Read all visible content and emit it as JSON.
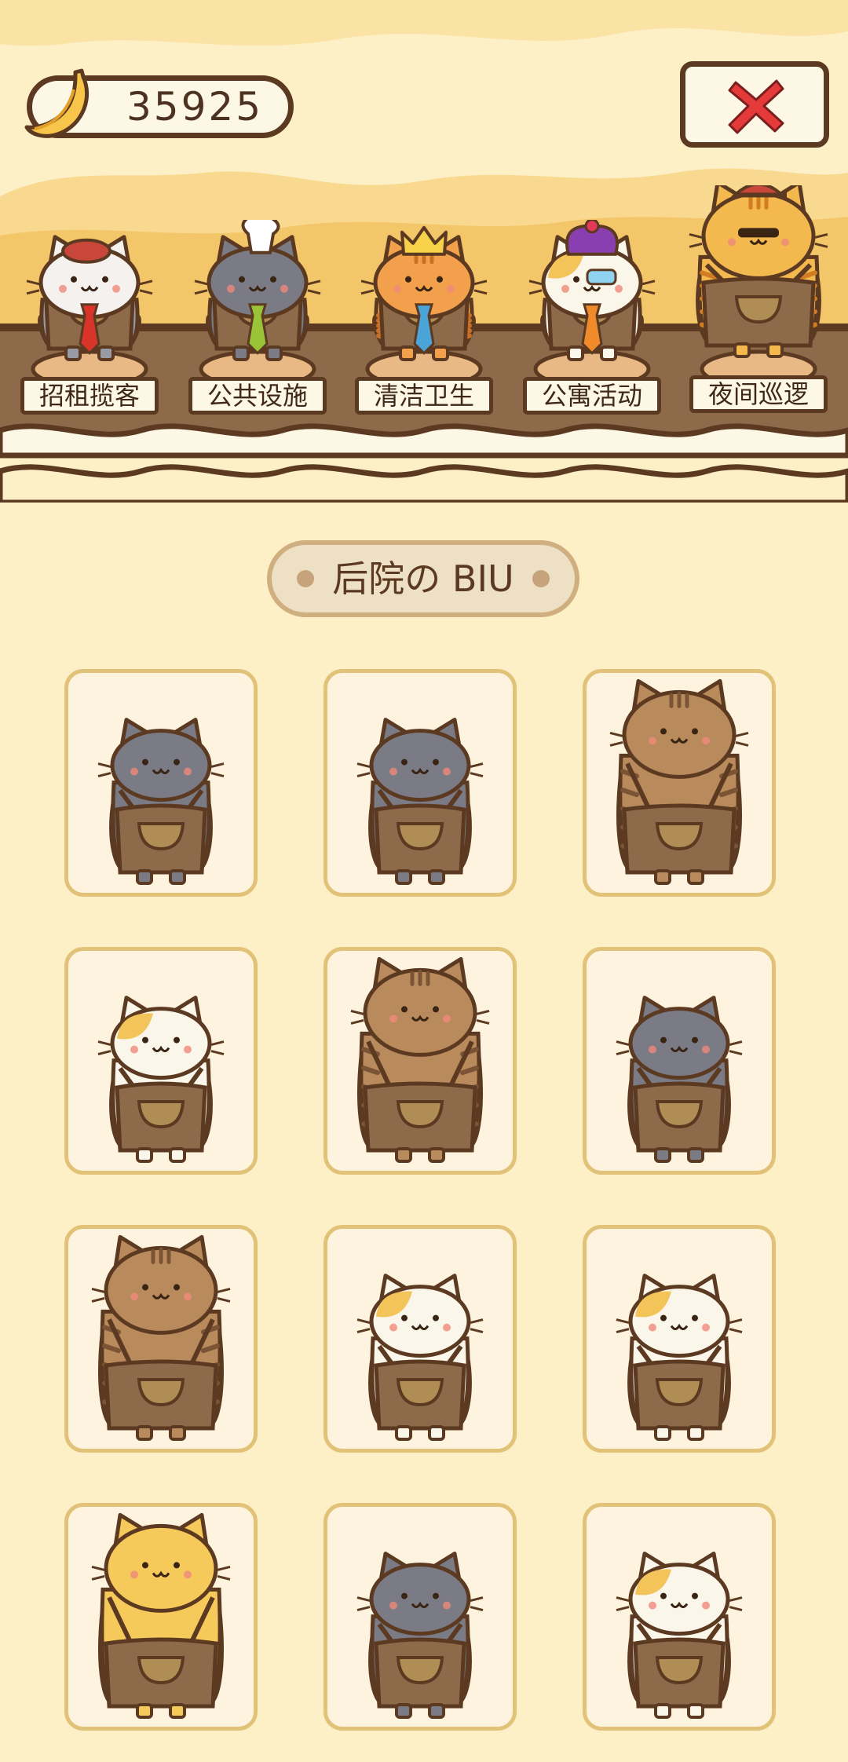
{
  "currency": {
    "icon": "banana-icon",
    "amount": "35925"
  },
  "close": {
    "icon": "close-x-icon",
    "color": "#e53a3a"
  },
  "workers": [
    {
      "label": "招租揽客",
      "cat": "grey-white",
      "accessory": "beret",
      "tie": "red"
    },
    {
      "label": "公共设施",
      "cat": "grey",
      "accessory": "chef-hat",
      "tie": "green"
    },
    {
      "label": "清洁卫生",
      "cat": "orange-tabby",
      "accessory": "crown",
      "tie": "blue"
    },
    {
      "label": "公寓活动",
      "cat": "calico",
      "accessory": "jester-hat",
      "tie": "orange"
    },
    {
      "label": "夜间巡逻",
      "cat": "orange-striped",
      "accessory": "police-cap",
      "tie": "none"
    }
  ],
  "section": {
    "title": "后院の BIU"
  },
  "cats": [
    {
      "cat": "grey",
      "size": "small"
    },
    {
      "cat": "grey",
      "size": "small"
    },
    {
      "cat": "brown-tabby",
      "size": "large"
    },
    {
      "cat": "calico",
      "size": "small"
    },
    {
      "cat": "brown-tabby",
      "size": "large"
    },
    {
      "cat": "grey",
      "size": "small"
    },
    {
      "cat": "brown-tabby",
      "size": "large"
    },
    {
      "cat": "calico",
      "size": "small"
    },
    {
      "cat": "calico",
      "size": "small"
    },
    {
      "cat": "orange",
      "size": "large"
    },
    {
      "cat": "grey",
      "size": "small"
    },
    {
      "cat": "calico",
      "size": "small"
    }
  ],
  "colors": {
    "background": "#fdefc6",
    "shelf": "#8c6a4a",
    "outline": "#5c3a22",
    "card_border": "#e2c278"
  }
}
